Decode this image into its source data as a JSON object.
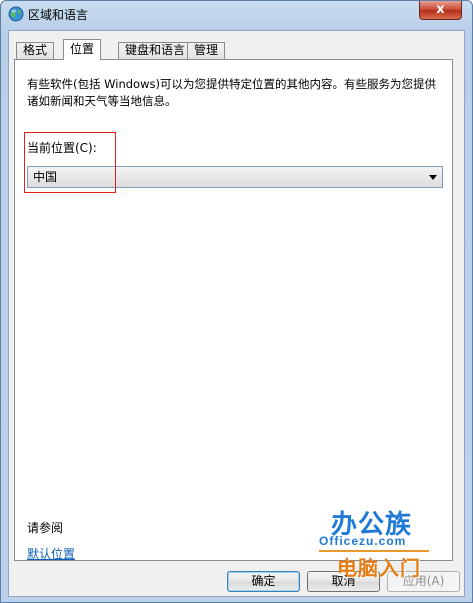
{
  "window": {
    "title": "区域和语言",
    "close_glyph": "x",
    "icon": "globe-icon"
  },
  "tabs": [
    {
      "label": "格式",
      "active": false
    },
    {
      "label": "位置",
      "active": true
    },
    {
      "label": "键盘和语言",
      "active": false
    },
    {
      "label": "管理",
      "active": false
    }
  ],
  "panel": {
    "description": "有些软件(包括 Windows)可以为您提供特定位置的其他内容。有些服务为您提供诸如新闻和天气等当地信息。",
    "location_label": "当前位置(C):",
    "location_value": "中国",
    "see_also": "请参阅",
    "default_location_link": "默认位置"
  },
  "buttons": {
    "ok": "确定",
    "cancel": "取消",
    "apply": "应用(A)"
  },
  "watermark": {
    "main": "办公族",
    "site": "Officezu.com",
    "sub": "电脑入门"
  },
  "colors": {
    "highlight": "#e0201b",
    "link": "#0a5fb4",
    "watermark_blue": "#1f7ad6",
    "watermark_orange": "#e47e14"
  }
}
